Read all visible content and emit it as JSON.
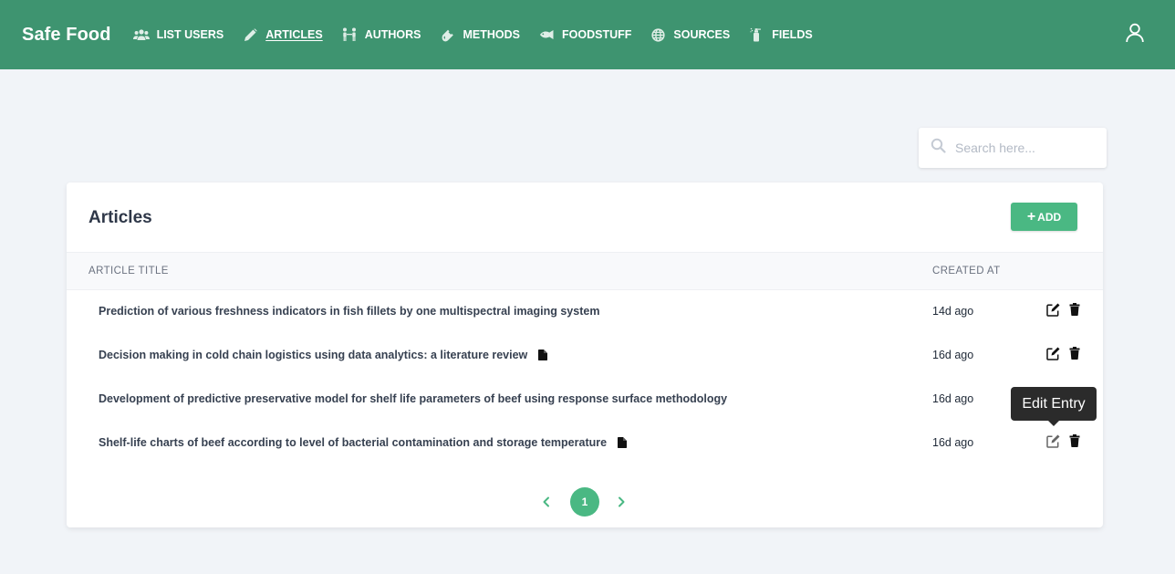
{
  "app": {
    "brand": "Safe Food"
  },
  "nav": [
    {
      "label": "LIST USERS",
      "icon": "users-icon",
      "active": false
    },
    {
      "label": "ARTICLES",
      "icon": "pencil-icon",
      "active": true
    },
    {
      "label": "AUTHORS",
      "icon": "authors-icon",
      "active": false
    },
    {
      "label": "METHODS",
      "icon": "flask-icon",
      "active": false
    },
    {
      "label": "FOODSTUFF",
      "icon": "fish-icon",
      "active": false
    },
    {
      "label": "SOURCES",
      "icon": "globe-icon",
      "active": false
    },
    {
      "label": "FIELDS",
      "icon": "spray-icon",
      "active": false
    }
  ],
  "user_icon": "user-icon",
  "search": {
    "placeholder": "Search here..."
  },
  "card": {
    "title": "Articles",
    "add_label": "ADD",
    "columns": {
      "title": "ARTICLE TITLE",
      "created": "CREATED AT"
    },
    "rows": [
      {
        "title": "Prediction of various freshness indicators in fish fillets by one multispectral imaging system",
        "created": "14d ago",
        "has_doc": false
      },
      {
        "title": "Decision making in cold chain logistics using data analytics: a literature review",
        "created": "16d ago",
        "has_doc": true
      },
      {
        "title": "Development of predictive preservative model for shelf life parameters of beef using response surface methodology",
        "created": "16d ago",
        "has_doc": false
      },
      {
        "title": "Shelf-life charts of beef according to level of bacterial contamination and storage temperature",
        "created": "16d ago",
        "has_doc": true
      }
    ]
  },
  "pagination": {
    "current": "1"
  },
  "tooltip": {
    "text": "Edit Entry"
  },
  "colors": {
    "header": "#3e9470",
    "accent": "#4ab883",
    "background": "#f1f4f8"
  }
}
